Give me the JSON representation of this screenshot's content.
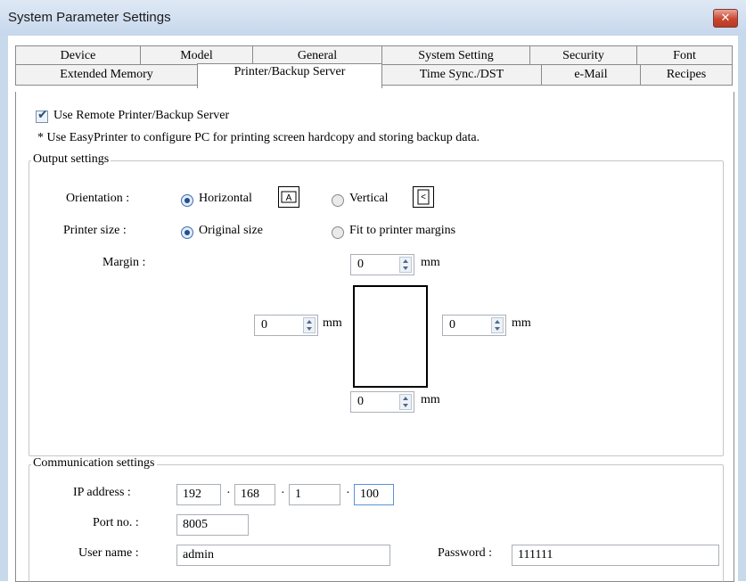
{
  "window": {
    "title": "System Parameter Settings",
    "close_glyph": "✕"
  },
  "tabs_row1": [
    "Device",
    "Model",
    "General",
    "System Setting",
    "Security",
    "Font"
  ],
  "tabs_row2": [
    "Extended Memory",
    "Printer/Backup Server",
    "Time Sync./DST",
    "e-Mail",
    "Recipes"
  ],
  "active_tab": "Printer/Backup Server",
  "use_remote": {
    "checked": true,
    "label": "Use Remote Printer/Backup Server"
  },
  "note": "* Use EasyPrinter to configure PC for printing screen hardcopy and storing backup data.",
  "output": {
    "title": "Output settings",
    "orientation_label": "Orientation :",
    "horizontal_label": "Horizontal",
    "vertical_label": "Vertical",
    "orientation_selected": "Horizontal",
    "printer_size_label": "Printer size :",
    "original_size_label": "Original size",
    "fit_label": "Fit to printer margins",
    "printer_size_selected": "Original size",
    "margin_label": "Margin :",
    "margin_top": "0",
    "margin_left": "0",
    "margin_right": "0",
    "margin_bottom": "0",
    "unit": "mm",
    "icon_h": "A",
    "icon_v": "<"
  },
  "comm": {
    "title": "Communication settings",
    "ip_label": "IP address :",
    "ip": [
      "192",
      "168",
      "1",
      "100"
    ],
    "ip_sep": "·",
    "port_label": "Port no. :",
    "port": "8005",
    "user_label": "User name :",
    "user": "admin",
    "password_label": "Password :",
    "password": "111111"
  }
}
